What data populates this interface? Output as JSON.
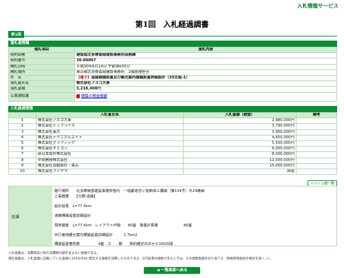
{
  "header": {
    "service": "入札情報サービス",
    "title": "第1回　入札経過調書",
    "tab": "第1回"
  },
  "award_info": {
    "section_title": "落札者情報",
    "col_item": "落札項目",
    "col_content": "落札内容",
    "rows": [
      {
        "label": "契約部署",
        "value": "建設局北多摩南部建設事務所庶務課"
      },
      {
        "label": "契約番号",
        "value": "30-00067"
      },
      {
        "label": "開札日時",
        "value": "平成30年6月14日 午前9時30分"
      },
      {
        "label": "開札場所",
        "value": "東京都北多摩南部建設事務所　2階経理担当"
      },
      {
        "label": "件　名",
        "value_prefix": "【電子】",
        "value": "道路標識設置及び観光案内標識設置詳細設計（30北南-1）"
      },
      {
        "label": "落札者氏名",
        "value": "株式会社アスコ大東"
      },
      {
        "label": "落札金額",
        "value": "3,218,400円"
      },
      {
        "label": "公表通知書",
        "value": "閲覧の現金価額"
      }
    ]
  },
  "bid_history": {
    "section_title": "入札経過情報",
    "col_no": "",
    "col_name": "入札者氏名",
    "col_amount": "入札金額（税抜）",
    "col_note": "備考",
    "rows": [
      {
        "no": "1",
        "name": "株式会社アスコ大東",
        "amount": "2,980,000円",
        "note": ""
      },
      {
        "no": "2",
        "name": "株式会社トップライズ",
        "amount": "3,790,000円",
        "note": ""
      },
      {
        "no": "3",
        "name": "株式会社長大",
        "amount": "3,900,000円",
        "note": ""
      },
      {
        "no": "4",
        "name": "株式会社テクニカルエイト",
        "amount": "4,450,000円",
        "note": ""
      },
      {
        "no": "5",
        "name": "株式会社グラフィック",
        "amount": "5,500,000円",
        "note": ""
      },
      {
        "no": "6",
        "name": "株式会社キミコン",
        "amount": "6,000,000円",
        "note": ""
      },
      {
        "no": "7",
        "name": "新日本設計株式会社",
        "amount": "8,000,000円",
        "note": ""
      },
      {
        "no": "8",
        "name": "中央開発株式会社",
        "amount": "12,000,000円",
        "note": ""
      },
      {
        "no": "9",
        "name": "株式会社景観設計・東京",
        "amount": "15,000,000円",
        "note": ""
      },
      {
        "no": "10",
        "name": "株式会社フジヤマ",
        "amount": "辞退",
        "note": ""
      }
    ],
    "hash_button": "ハッシュ値一覧"
  },
  "remarks": {
    "label": "記事",
    "lines": [
      "履行場所　　北多摩南部建設事務所管内　一般都道恋ヶ窪新田三鷹線（第134号）外24路線",
      "工事概要　　【分野:道路】",
      "設計延長　L=77.4km",
      "道路標識設置詳細設計",
      "現地踏査　L=77.4km　レイアウト作製　　80基　数量計算書　　　　　　　80基",
      "歩行者用観光案内標識設置詳細設計　　　1.7km2",
      "標識設置箇所数　　　　　4基　工　　期　　契約確定の日から160日間"
    ]
  },
  "footer": {
    "note1": "入札金額は、消費税及び地方消費税の額を含まない金額である。",
    "note2": "落札金額は、入札金額に記載している金額に100分の8に相当する金額を加算したものである（1円未満の端数があるときは、その端数金額を切り捨てる（単数単価契約の場合を除く。））。",
    "back_button": "一覧画面へ戻る"
  }
}
